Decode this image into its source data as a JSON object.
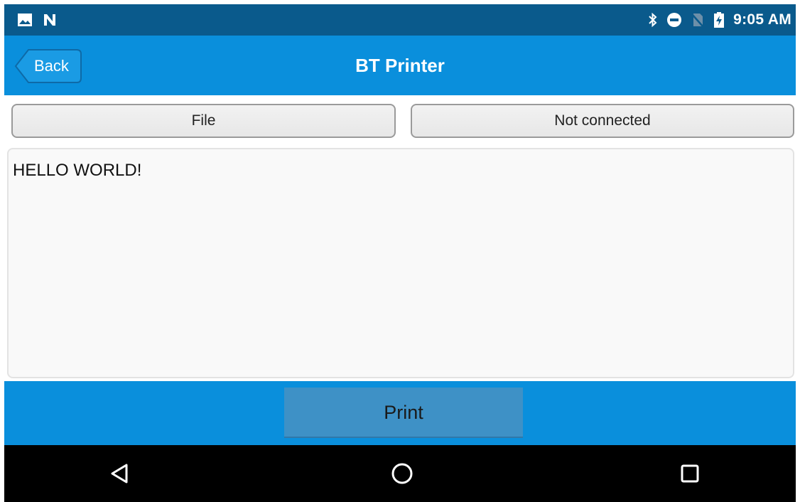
{
  "status_bar": {
    "time": "9:05 AM",
    "left_icons": [
      "image-icon",
      "n-app-icon"
    ],
    "right_icons": [
      "bluetooth-icon",
      "do-not-disturb-icon",
      "no-sim-icon",
      "battery-charging-icon"
    ]
  },
  "app_bar": {
    "back_label": "Back",
    "title": "BT Printer"
  },
  "buttons": {
    "file_label": "File",
    "connection_label": "Not connected"
  },
  "editor": {
    "content": "HELLO WORLD!"
  },
  "action_bar": {
    "print_label": "Print"
  },
  "nav_bar": {
    "icons": [
      "nav-back-icon",
      "nav-home-icon",
      "nav-recents-icon"
    ]
  },
  "colors": {
    "status_bar": "#0a5a8c",
    "app_bar": "#0a8fdc",
    "print_button": "#3e91c6",
    "nav_bar": "#000000"
  }
}
